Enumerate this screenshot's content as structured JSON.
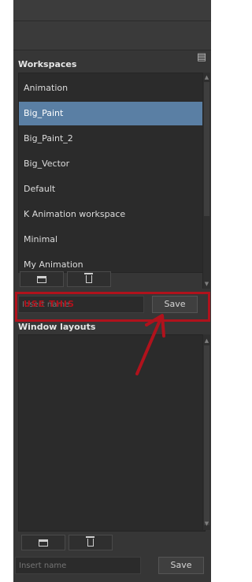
{
  "workspaces": {
    "title": "Workspaces",
    "items": [
      {
        "label": "Animation"
      },
      {
        "label": "Big_Paint"
      },
      {
        "label": "Big_Paint_2"
      },
      {
        "label": "Big_Vector"
      },
      {
        "label": "Default"
      },
      {
        "label": "K Animation workspace"
      },
      {
        "label": "Minimal"
      },
      {
        "label": "My Animation"
      }
    ],
    "selected": "Big_Paint",
    "name_input": {
      "value": "Insert name",
      "placeholder": "Insert name"
    },
    "save_label": "Save"
  },
  "annotation": {
    "text": "USE THIS",
    "color": "#b0121c"
  },
  "window_layouts": {
    "title": "Window layouts",
    "name_input": {
      "value": "",
      "placeholder": "Insert name"
    },
    "save_label": "Save"
  },
  "icons": {
    "panel_menu": "panel-menu-icon",
    "new": "folder-icon",
    "delete": "trash-icon",
    "arrow": "annotation-arrow"
  },
  "colors": {
    "panel_bg": "#363636",
    "list_bg": "#2b2b2b",
    "selected_row": "#5a7fa4",
    "annotation_red": "#b0121c"
  }
}
